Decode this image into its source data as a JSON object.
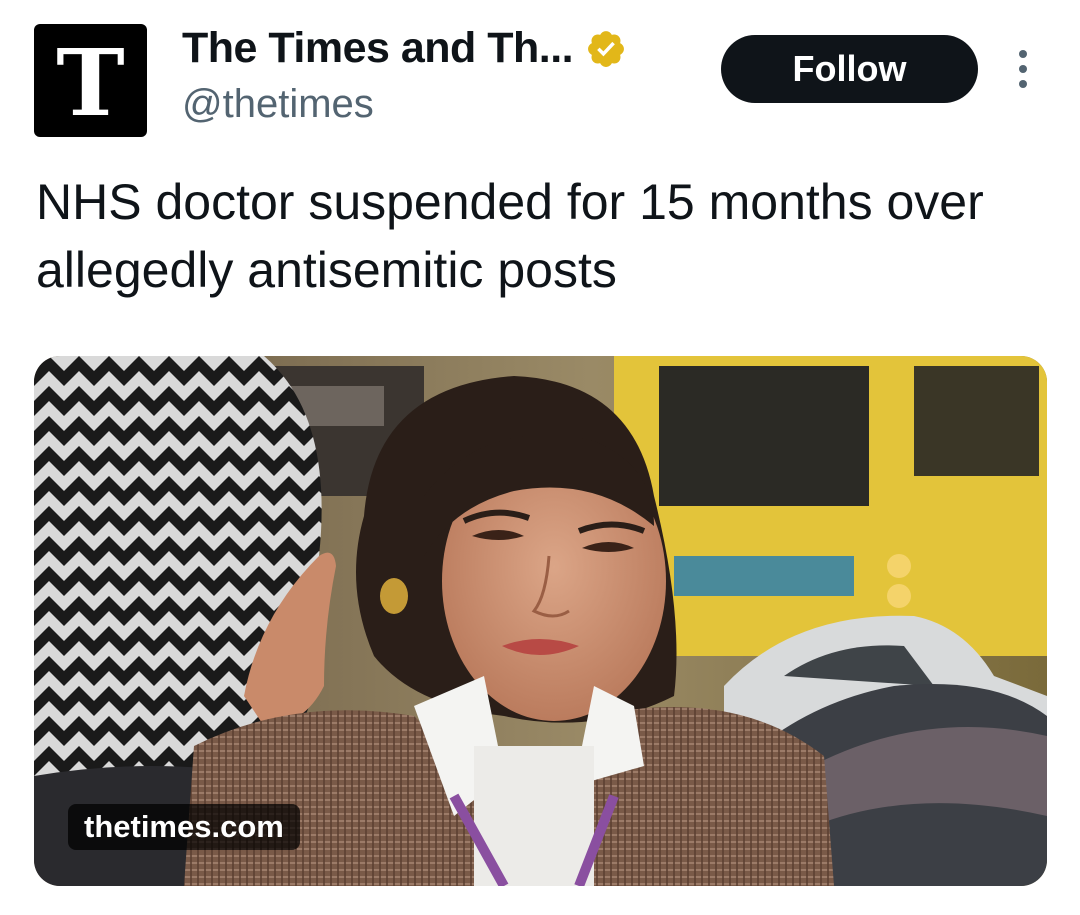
{
  "tweet": {
    "author": {
      "avatar_letter": "T",
      "display_name": "The Times and Th...",
      "handle": "@thetimes",
      "verified_badge": "gold-verified-icon",
      "verified_color": "#e2b719"
    },
    "follow_label": "Follow",
    "more_icon": "more-options-icon",
    "headline": "NHS doctor suspended for 15 months over allegedly antisemitic posts",
    "link_card": {
      "domain": "thetimes.com",
      "image": "photo-woman-smiling-in-street-with-yellow-bus"
    }
  },
  "colors": {
    "text_primary": "#0f1419",
    "text_secondary": "#536471",
    "follow_bg": "#0f1419",
    "follow_text": "#ffffff"
  }
}
